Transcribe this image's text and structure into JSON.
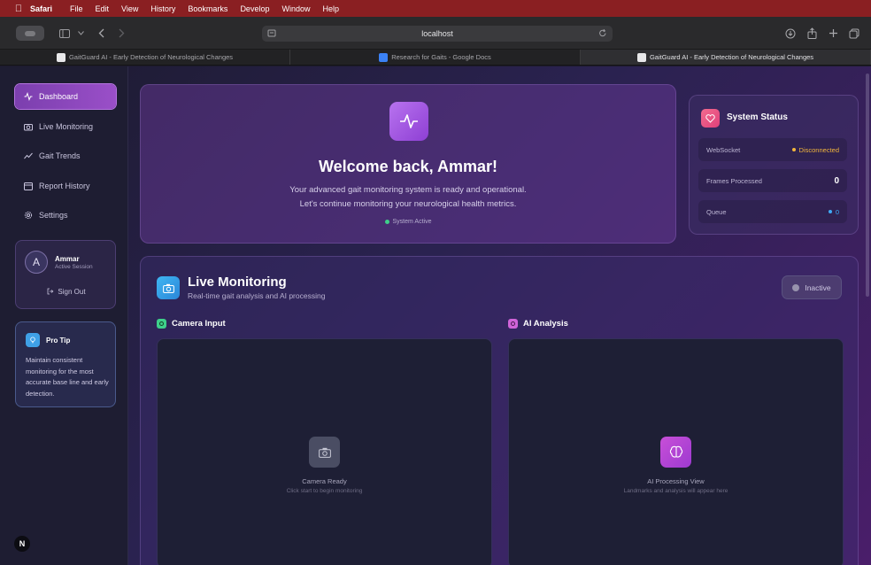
{
  "menubar": {
    "items": [
      "Safari",
      "File",
      "Edit",
      "View",
      "History",
      "Bookmarks",
      "Develop",
      "Window",
      "Help"
    ]
  },
  "toolbar": {
    "url": "localhost"
  },
  "tabs": [
    {
      "label": "GaitGuard AI - Early Detection of Neurological Changes"
    },
    {
      "label": "Research for Gaits - Google Docs"
    },
    {
      "label": "GaitGuard AI - Early Detection of Neurological Changes"
    }
  ],
  "sidebar": {
    "items": [
      {
        "label": "Dashboard",
        "icon": "activity-icon"
      },
      {
        "label": "Live Monitoring",
        "icon": "camera-icon"
      },
      {
        "label": "Gait Trends",
        "icon": "trend-icon"
      },
      {
        "label": "Report History",
        "icon": "calendar-icon"
      },
      {
        "label": "Settings",
        "icon": "gear-icon"
      }
    ],
    "user": {
      "initial": "A",
      "name": "Ammar",
      "status": "Active Session",
      "signout": "Sign Out"
    },
    "tip": {
      "title": "Pro Tip",
      "text": "Maintain consistent monitoring for the most accurate base line and early detection."
    },
    "badge": "N"
  },
  "welcome": {
    "title": "Welcome back, Ammar!",
    "line1": "Your advanced gait monitoring system is ready and operational.",
    "line2": "Let's continue monitoring your neurological health metrics.",
    "status": "System Active"
  },
  "system_status": {
    "title": "System Status",
    "rows": [
      {
        "label": "WebSocket",
        "value": "Disconnected"
      },
      {
        "label": "Frames Processed",
        "value": "0"
      },
      {
        "label": "Queue",
        "value": "0"
      }
    ]
  },
  "live": {
    "title": "Live Monitoring",
    "subtitle": "Real-time gait analysis and AI processing",
    "state": "Inactive",
    "camera": {
      "title": "Camera Input",
      "ready": "Camera Ready",
      "hint": "Click start to begin monitoring"
    },
    "ai": {
      "title": "AI Analysis",
      "ready": "AI Processing View",
      "hint": "Landmarks and analysis will appear here"
    }
  },
  "colors": {
    "accent": "#9a4fc8",
    "warn": "#f2b63c",
    "ok": "#3ed08a",
    "info": "#3fa9f5"
  }
}
